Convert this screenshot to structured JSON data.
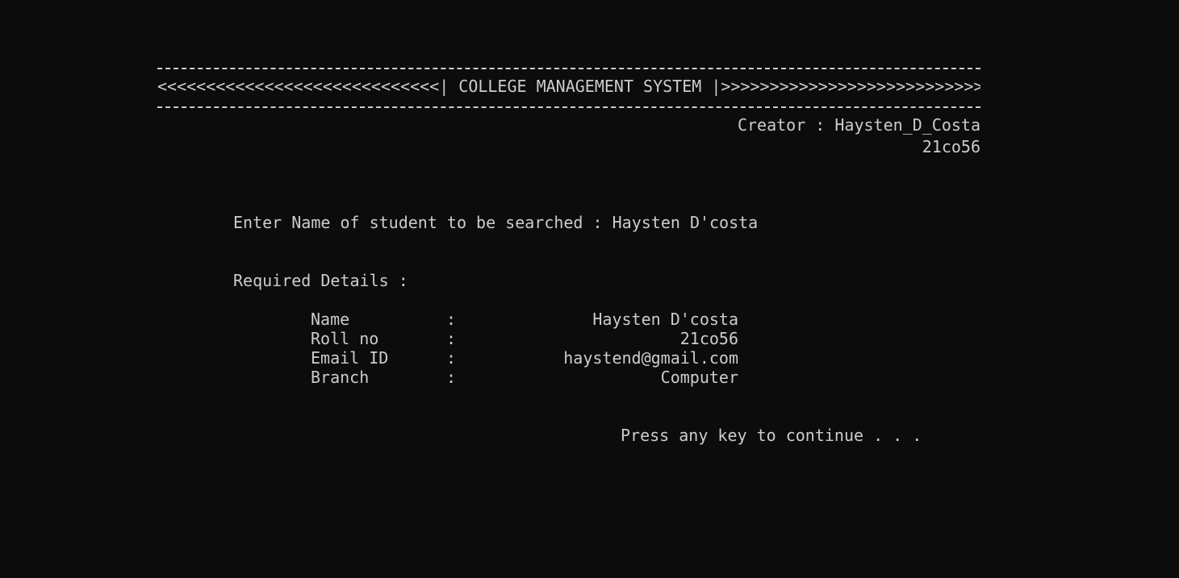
{
  "header": {
    "title_line": "<<<<<<<<<<<<<<<<<<<<<<<<<<<<<| COLLEGE MANAGEMENT SYSTEM |>>>>>>>>>>>>>>>>>>>>>>>>>>>>>",
    "creator": "Creator : Haysten_D_Costa",
    "creator_id": "21co56"
  },
  "search": {
    "prompt": "Enter Name of student to be searched : ",
    "value": "Haysten D'costa"
  },
  "details": {
    "heading": "Required Details :",
    "rows": [
      {
        "label": "Name",
        "sep": ":",
        "value": "Haysten D'costa"
      },
      {
        "label": "Roll no",
        "sep": ":",
        "value": "21co56"
      },
      {
        "label": "Email ID",
        "sep": ":",
        "value": "haystend@gmail.com"
      },
      {
        "label": "Branch",
        "sep": ":",
        "value": "Computer"
      }
    ]
  },
  "footer": {
    "continue_prompt": "Press any key to continue . . ."
  }
}
